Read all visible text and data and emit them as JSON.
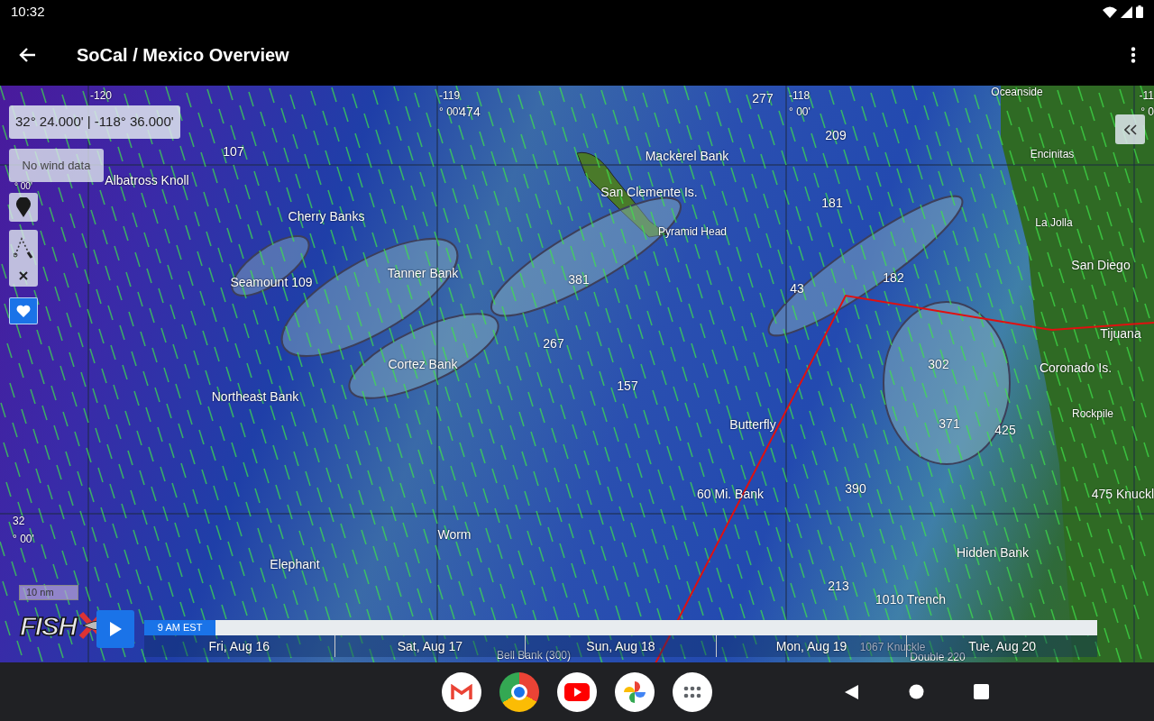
{
  "status_bar": {
    "time": "10:32"
  },
  "app_bar": {
    "title": "SoCal / Mexico Overview"
  },
  "map": {
    "coordinates": "32° 24.000' | -118° 36.000'",
    "wind_status": "No wind data",
    "favorite": {
      "on": true
    },
    "scale": "10 nm",
    "logo": "FISH",
    "grid_labels": [
      "-120",
      "-119",
      "° 00'",
      "-118",
      "° 00'",
      "-11",
      "° 0",
      "° 00'",
      "32",
      "° 00'"
    ],
    "depth_labels": [
      "277",
      "209",
      "107",
      "181",
      "182",
      "381",
      "43",
      "267",
      "157",
      "302",
      "371",
      "425",
      "390",
      "213",
      "474"
    ],
    "place_labels": [
      "Oceanside",
      "Encinitas",
      "Mackerel Bank",
      "San Clemente Is.",
      "Pyramid Head",
      "Albatross Knoll",
      "Cherry Banks",
      "La Jolla",
      "San Diego",
      "Seamount 109",
      "Tanner Bank",
      "Tijuana",
      "Cortez Bank",
      "Coronado Is.",
      "Northeast Bank",
      "Rockpile",
      "Butterfly",
      "60 Mi. Bank",
      "475 Knuckl",
      "Worm",
      "Hidden Bank",
      "Elephant",
      "1010 Trench",
      "Bell Bank (300)",
      "1067 Knuckle",
      "Double 220"
    ]
  },
  "timeline": {
    "current_time": "9 AM EST",
    "level": 0.075,
    "days": [
      "Fri, Aug 16",
      "Sat, Aug 17",
      "Sun, Aug 18",
      "Mon, Aug 19",
      "Tue, Aug 20"
    ]
  }
}
